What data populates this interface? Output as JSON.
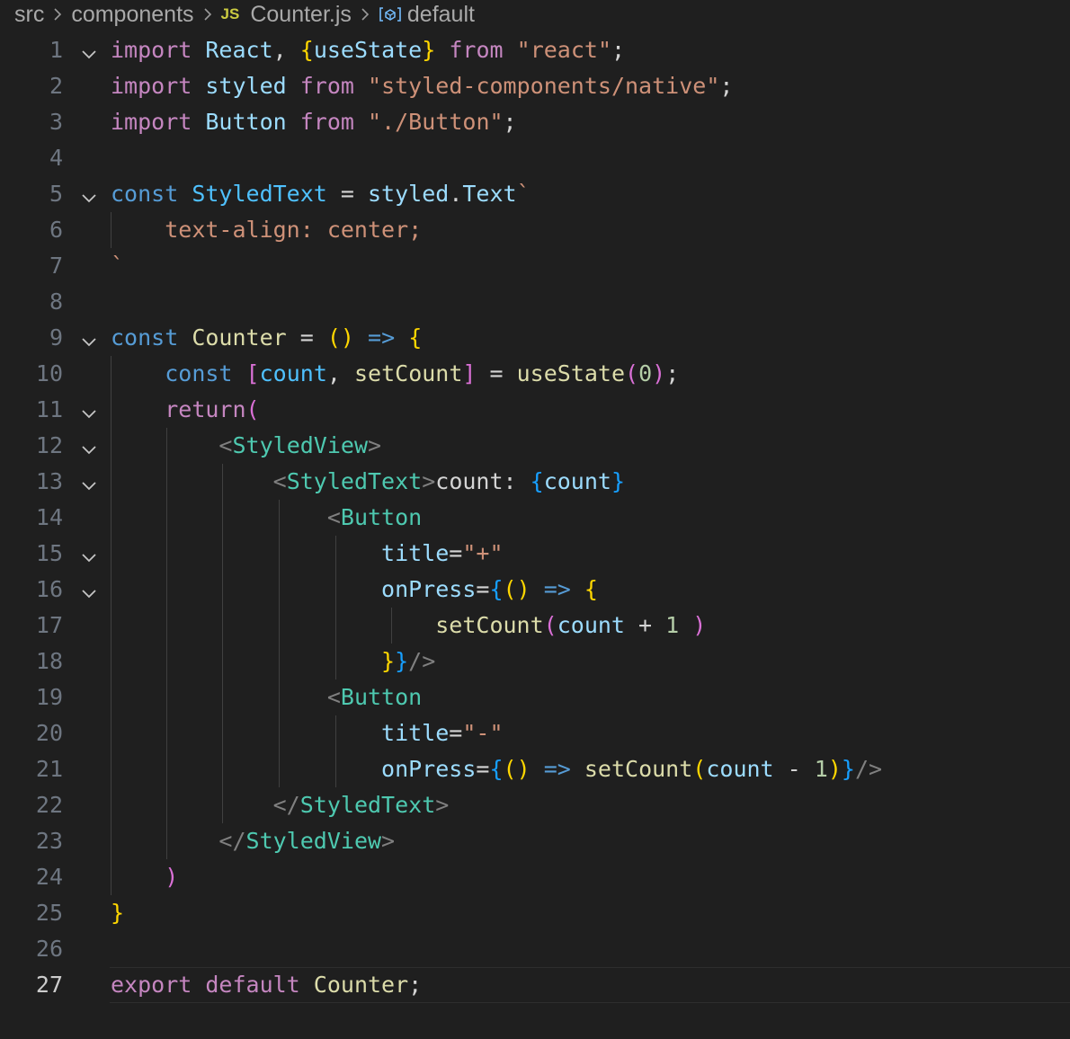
{
  "breadcrumb": {
    "folder1": "src",
    "folder2": "components",
    "file_badge": "JS",
    "file": "Counter.js",
    "symbol": "default"
  },
  "editor": {
    "active_line": 27,
    "lines": [
      {
        "n": "1",
        "fold": true,
        "tokens": [
          [
            "import",
            "kw"
          ],
          [
            " ",
            "plain"
          ],
          [
            "React",
            "var"
          ],
          [
            ", ",
            "plain"
          ],
          [
            "{",
            "br1"
          ],
          [
            "useState",
            "var"
          ],
          [
            "}",
            "br1"
          ],
          [
            " ",
            "plain"
          ],
          [
            "from",
            "kw"
          ],
          [
            " ",
            "plain"
          ],
          [
            "\"react\"",
            "str"
          ],
          [
            ";",
            "plain"
          ]
        ]
      },
      {
        "n": "2",
        "fold": false,
        "tokens": [
          [
            "import",
            "kw"
          ],
          [
            " ",
            "plain"
          ],
          [
            "styled",
            "var"
          ],
          [
            " ",
            "plain"
          ],
          [
            "from",
            "kw"
          ],
          [
            " ",
            "plain"
          ],
          [
            "\"styled-components/native\"",
            "str"
          ],
          [
            ";",
            "plain"
          ]
        ]
      },
      {
        "n": "3",
        "fold": false,
        "tokens": [
          [
            "import",
            "kw"
          ],
          [
            " ",
            "plain"
          ],
          [
            "Button",
            "var"
          ],
          [
            " ",
            "plain"
          ],
          [
            "from",
            "kw"
          ],
          [
            " ",
            "plain"
          ],
          [
            "\"./Button\"",
            "str"
          ],
          [
            ";",
            "plain"
          ]
        ]
      },
      {
        "n": "4",
        "fold": false,
        "tokens": []
      },
      {
        "n": "5",
        "fold": true,
        "tokens": [
          [
            "const",
            "store"
          ],
          [
            " ",
            "plain"
          ],
          [
            "StyledText",
            "const"
          ],
          [
            " = ",
            "plain"
          ],
          [
            "styled",
            "var"
          ],
          [
            ".",
            "plain"
          ],
          [
            "Text",
            "var"
          ],
          [
            "`",
            "css"
          ]
        ]
      },
      {
        "n": "6",
        "fold": false,
        "tokens": [
          [
            "    ",
            "plain"
          ],
          [
            "text-align: center;",
            "css"
          ]
        ]
      },
      {
        "n": "7",
        "fold": false,
        "tokens": [
          [
            "`",
            "css"
          ]
        ]
      },
      {
        "n": "8",
        "fold": false,
        "tokens": []
      },
      {
        "n": "9",
        "fold": true,
        "tokens": [
          [
            "const",
            "store"
          ],
          [
            " ",
            "plain"
          ],
          [
            "Counter",
            "fn"
          ],
          [
            " = ",
            "plain"
          ],
          [
            "()",
            "br1"
          ],
          [
            " ",
            "plain"
          ],
          [
            "=>",
            "store"
          ],
          [
            " ",
            "plain"
          ],
          [
            "{",
            "br1"
          ]
        ]
      },
      {
        "n": "10",
        "fold": false,
        "tokens": [
          [
            "    ",
            "plain"
          ],
          [
            "const",
            "store"
          ],
          [
            " ",
            "plain"
          ],
          [
            "[",
            "br2"
          ],
          [
            "count",
            "const"
          ],
          [
            ", ",
            "plain"
          ],
          [
            "setCount",
            "fn"
          ],
          [
            "]",
            "br2"
          ],
          [
            " = ",
            "plain"
          ],
          [
            "useState",
            "fn"
          ],
          [
            "(",
            "br2"
          ],
          [
            "0",
            "num"
          ],
          [
            ")",
            "br2"
          ],
          [
            ";",
            "plain"
          ]
        ]
      },
      {
        "n": "11",
        "fold": true,
        "tokens": [
          [
            "    ",
            "plain"
          ],
          [
            "return",
            "kw"
          ],
          [
            "(",
            "br2"
          ]
        ]
      },
      {
        "n": "12",
        "fold": true,
        "tokens": [
          [
            "        ",
            "plain"
          ],
          [
            "<",
            "punct"
          ],
          [
            "StyledView",
            "tag"
          ],
          [
            ">",
            "punct"
          ]
        ]
      },
      {
        "n": "13",
        "fold": true,
        "tokens": [
          [
            "            ",
            "plain"
          ],
          [
            "<",
            "punct"
          ],
          [
            "StyledText",
            "tag"
          ],
          [
            ">",
            "punct"
          ],
          [
            "count: ",
            "plain"
          ],
          [
            "{",
            "br3"
          ],
          [
            "count",
            "var"
          ],
          [
            "}",
            "br3"
          ]
        ]
      },
      {
        "n": "14",
        "fold": false,
        "tokens": [
          [
            "                ",
            "plain"
          ],
          [
            "<",
            "punct"
          ],
          [
            "Button",
            "tag"
          ]
        ]
      },
      {
        "n": "15",
        "fold": true,
        "tokens": [
          [
            "                    ",
            "plain"
          ],
          [
            "title",
            "var"
          ],
          [
            "=",
            "plain"
          ],
          [
            "\"+\"",
            "str"
          ]
        ]
      },
      {
        "n": "16",
        "fold": true,
        "tokens": [
          [
            "                    ",
            "plain"
          ],
          [
            "onPress",
            "var"
          ],
          [
            "=",
            "plain"
          ],
          [
            "{",
            "br3"
          ],
          [
            "()",
            "br1"
          ],
          [
            " ",
            "plain"
          ],
          [
            "=>",
            "store"
          ],
          [
            " ",
            "plain"
          ],
          [
            "{",
            "br1"
          ]
        ]
      },
      {
        "n": "17",
        "fold": false,
        "tokens": [
          [
            "                        ",
            "plain"
          ],
          [
            "setCount",
            "fn"
          ],
          [
            "(",
            "br2"
          ],
          [
            "count",
            "var"
          ],
          [
            " + ",
            "plain"
          ],
          [
            "1",
            "num"
          ],
          [
            " ",
            "plain"
          ],
          [
            ")",
            "br2"
          ]
        ]
      },
      {
        "n": "18",
        "fold": false,
        "tokens": [
          [
            "                    ",
            "plain"
          ],
          [
            "}",
            "br1"
          ],
          [
            "}",
            "br3"
          ],
          [
            "/>",
            "punct"
          ]
        ]
      },
      {
        "n": "19",
        "fold": false,
        "tokens": [
          [
            "                ",
            "plain"
          ],
          [
            "<",
            "punct"
          ],
          [
            "Button",
            "tag"
          ]
        ]
      },
      {
        "n": "20",
        "fold": false,
        "tokens": [
          [
            "                    ",
            "plain"
          ],
          [
            "title",
            "var"
          ],
          [
            "=",
            "plain"
          ],
          [
            "\"-\"",
            "str"
          ]
        ]
      },
      {
        "n": "21",
        "fold": false,
        "tokens": [
          [
            "                    ",
            "plain"
          ],
          [
            "onPress",
            "var"
          ],
          [
            "=",
            "plain"
          ],
          [
            "{",
            "br3"
          ],
          [
            "()",
            "br1"
          ],
          [
            " ",
            "plain"
          ],
          [
            "=>",
            "store"
          ],
          [
            " ",
            "plain"
          ],
          [
            "setCount",
            "fn"
          ],
          [
            "(",
            "br1"
          ],
          [
            "count",
            "var"
          ],
          [
            " - ",
            "plain"
          ],
          [
            "1",
            "num"
          ],
          [
            ")",
            "br1"
          ],
          [
            "}",
            "br3"
          ],
          [
            "/>",
            "punct"
          ]
        ]
      },
      {
        "n": "22",
        "fold": false,
        "tokens": [
          [
            "            ",
            "plain"
          ],
          [
            "</",
            "punct"
          ],
          [
            "StyledText",
            "tag"
          ],
          [
            ">",
            "punct"
          ]
        ]
      },
      {
        "n": "23",
        "fold": false,
        "tokens": [
          [
            "        ",
            "plain"
          ],
          [
            "</",
            "punct"
          ],
          [
            "StyledView",
            "tag"
          ],
          [
            ">",
            "punct"
          ]
        ]
      },
      {
        "n": "24",
        "fold": false,
        "tokens": [
          [
            "    ",
            "plain"
          ],
          [
            ")",
            "br2"
          ]
        ]
      },
      {
        "n": "25",
        "fold": false,
        "tokens": [
          [
            "}",
            "br1"
          ]
        ]
      },
      {
        "n": "26",
        "fold": false,
        "tokens": []
      },
      {
        "n": "27",
        "fold": false,
        "tokens": [
          [
            "export",
            "kw"
          ],
          [
            " ",
            "plain"
          ],
          [
            "default",
            "kw"
          ],
          [
            " ",
            "plain"
          ],
          [
            "Counter",
            "fn"
          ],
          [
            ";",
            "plain"
          ]
        ]
      }
    ]
  }
}
